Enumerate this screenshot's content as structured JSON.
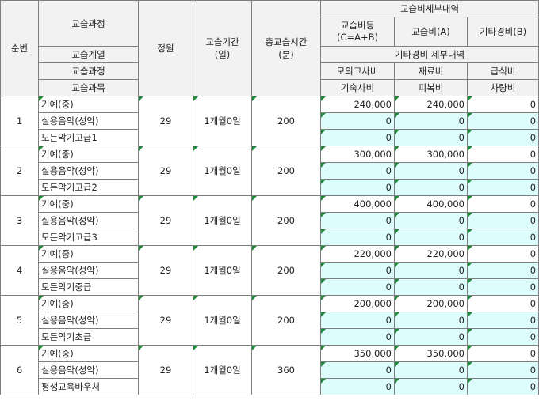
{
  "header": {
    "col_seq": "순번",
    "col_course": "교습과정",
    "col_capacity": "정원",
    "col_period": "교습기간\n(일)",
    "col_total_time": "총교습시간\n(분)",
    "col_fee_detail": "교습비세부내역",
    "col_fee_total": "교습비등\n(C=A+B)",
    "col_fee_a": "교습비(A)",
    "col_other_b": "기타경비(B)",
    "sub_category": "교습계열",
    "sub_process": "교습과정",
    "sub_subject": "교습과목",
    "other_detail": "기타경비 세부내역",
    "mock_exam": "모의고사비",
    "material": "재료비",
    "meal": "급식비",
    "dorm": "기숙사비",
    "clothing": "피복비",
    "vehicle": "차량비"
  },
  "rows": [
    {
      "seq": "1",
      "category": "기예(중)",
      "process": "실용음악(성악)",
      "subject": "모든악기고급1",
      "capacity": "29",
      "period": "1개월0일",
      "total_time": "200",
      "fee_total": "240,000",
      "fee_a": "240,000",
      "other_b": "0",
      "mock": "0",
      "material": "0",
      "meal": "0",
      "dorm": "0",
      "clothing": "0",
      "vehicle": "0"
    },
    {
      "seq": "2",
      "category": "기예(중)",
      "process": "실용음악(성악)",
      "subject": "모든악기고급2",
      "capacity": "29",
      "period": "1개월0일",
      "total_time": "200",
      "fee_total": "300,000",
      "fee_a": "300,000",
      "other_b": "0",
      "mock": "0",
      "material": "0",
      "meal": "0",
      "dorm": "0",
      "clothing": "0",
      "vehicle": "0"
    },
    {
      "seq": "3",
      "category": "기예(중)",
      "process": "실용음악(성악)",
      "subject": "모든악기고급3",
      "capacity": "29",
      "period": "1개월0일",
      "total_time": "200",
      "fee_total": "400,000",
      "fee_a": "400,000",
      "other_b": "0",
      "mock": "0",
      "material": "0",
      "meal": "0",
      "dorm": "0",
      "clothing": "0",
      "vehicle": "0"
    },
    {
      "seq": "4",
      "category": "기예(중)",
      "process": "실용음악(성악)",
      "subject": "모든악기중급",
      "capacity": "29",
      "period": "1개월0일",
      "total_time": "200",
      "fee_total": "220,000",
      "fee_a": "220,000",
      "other_b": "0",
      "mock": "0",
      "material": "0",
      "meal": "0",
      "dorm": "0",
      "clothing": "0",
      "vehicle": "0"
    },
    {
      "seq": "5",
      "category": "기예(중)",
      "process": "실용음악(성악)",
      "subject": "모든악기초급",
      "capacity": "29",
      "period": "1개월0일",
      "total_time": "200",
      "fee_total": "200,000",
      "fee_a": "200,000",
      "other_b": "0",
      "mock": "0",
      "material": "0",
      "meal": "0",
      "dorm": "0",
      "clothing": "0",
      "vehicle": "0"
    },
    {
      "seq": "6",
      "category": "기예(중)",
      "process": "실용음악(성악)",
      "subject": "평생교육바우처",
      "capacity": "29",
      "period": "1개월0일",
      "total_time": "360",
      "fee_total": "350,000",
      "fee_a": "350,000",
      "other_b": "0",
      "mock": "0",
      "material": "0",
      "meal": "0",
      "dorm": "0",
      "clothing": "0",
      "vehicle": "0"
    }
  ]
}
